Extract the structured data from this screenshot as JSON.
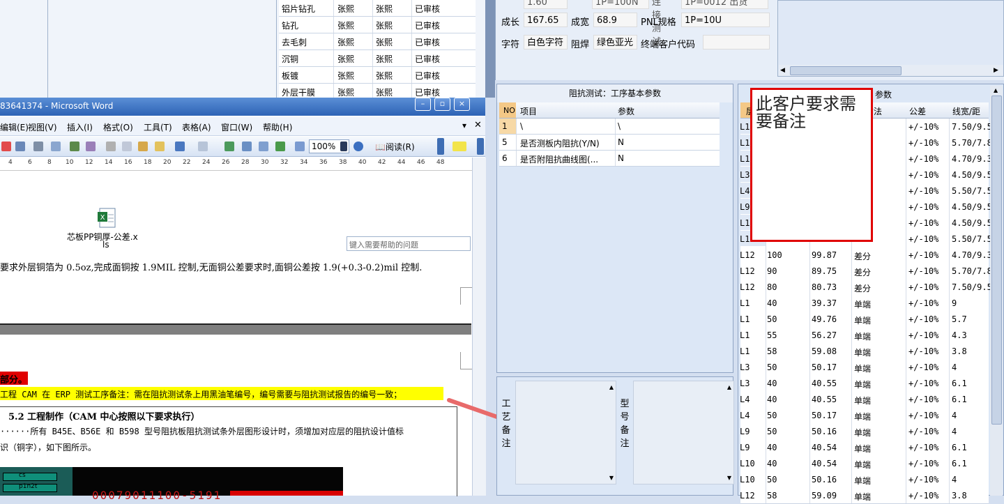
{
  "erp_process_table": [
    {
      "step": "铝片钻孔",
      "maker": "张熙",
      "checker": "张熙",
      "status": "已审核"
    },
    {
      "step": "钻孔",
      "maker": "张熙",
      "checker": "张熙",
      "status": "已审核"
    },
    {
      "step": "去毛刺",
      "maker": "张熙",
      "checker": "张熙",
      "status": "已审核"
    },
    {
      "step": "沉铜",
      "maker": "张熙",
      "checker": "张熙",
      "status": "已审核"
    },
    {
      "step": "板镀",
      "maker": "张熙",
      "checker": "张熙",
      "status": "已审核"
    },
    {
      "step": "外层干膜",
      "maker": "张熙",
      "checker": "张熙",
      "status": "已审核"
    }
  ],
  "word": {
    "title": "83641374 - Microsoft Word",
    "menu": [
      "编辑(E)",
      "视图(V)",
      "插入(I)",
      "格式(O)",
      "工具(T)",
      "表格(A)",
      "窗口(W)",
      "帮助(H)"
    ],
    "help_placeholder": "键入需要帮助的问题",
    "zoom": "100%",
    "read_label": "阅读(R)",
    "ruler": [
      "4",
      "6",
      "8",
      "10",
      "12",
      "14",
      "16",
      "18",
      "20",
      "22",
      "24",
      "26",
      "28",
      "30",
      "32",
      "34",
      "36",
      "38",
      "40",
      "42",
      "44",
      "46",
      "48"
    ],
    "embedded_file": "芯板PP铜厚-公差.x",
    "embedded_file_2": "ls",
    "line_copper": "要求外层铜箔为 0.5oz,完成面铜按 1.9MIL 控制,无面铜公差要求时,面铜公差按 1.9(+0.3-0.2)mil 控制.",
    "red_heading": "部分。",
    "yellow_line": "工程 CAM 在 ERP 测试工序备注：需在阻抗测试条上用黑油笔编号，编号需要与阻抗测试报告的编号一致；",
    "section_title": "5.2 工程制作（CAM 中心按照以下要求执行）",
    "para_1": "······所有 B45E、B56E 和 B598 型号阻抗板阻抗测试条外层图形设计时，须增加对应层的阻抗设计值标",
    "para_2": "识（铜字），如下图所示。",
    "fig_layers": [
      "cs",
      "p1n2t"
    ],
    "fig_text": "00079011100-5191"
  },
  "erp_header": {
    "row1": [
      {
        "label": "成长",
        "value": "167.65"
      },
      {
        "label": "成宽",
        "value": "68.9"
      },
      {
        "label": "PNL规格",
        "value": "1P=10U"
      }
    ],
    "row2": [
      {
        "label": "字符",
        "value": "白色字符"
      },
      {
        "label": "阻焊",
        "value": "绿色亚光"
      },
      {
        "label": "终端客户代码",
        "value": ""
      }
    ],
    "cut_top": [
      "1.60",
      "1P=100N",
      "连接测试",
      "1P=0012 出货"
    ]
  },
  "impedance_basic": {
    "caption": "阻抗测试：工序基本参数",
    "headers": [
      "NO",
      "项目",
      "参数"
    ],
    "rows": [
      {
        "no": "1",
        "item": "\\",
        "param": "\\"
      },
      {
        "no": "5",
        "item": "是否测板内阻抗(Y/N)",
        "param": "N"
      },
      {
        "no": "6",
        "item": "是否附阻抗曲线图(...",
        "param": "N"
      }
    ]
  },
  "notes": {
    "process_label": [
      "工",
      "艺",
      "备",
      "注"
    ],
    "model_label": [
      "型",
      "号",
      "备",
      "注"
    ]
  },
  "trace_table": {
    "caption_tail": "参数",
    "headers": [
      "层",
      "",
      "",
      "方法",
      "公差",
      "线宽/距"
    ],
    "rows": [
      [
        "L1",
        "",
        "",
        "",
        "+/-10%",
        "7.50/9.5"
      ],
      [
        "L1",
        "",
        "",
        "",
        "+/-10%",
        "5.70/7.8"
      ],
      [
        "L1",
        "",
        "",
        "",
        "+/-10%",
        "4.70/9.3"
      ],
      [
        "L3",
        "",
        "",
        "",
        "+/-10%",
        "4.50/9.5"
      ],
      [
        "L4",
        "",
        "",
        "",
        "+/-10%",
        "5.50/7.5"
      ],
      [
        "L9",
        "",
        "",
        "",
        "+/-10%",
        "4.50/9.5"
      ],
      [
        "L1",
        "",
        "",
        "",
        "+/-10%",
        "4.50/9.5"
      ],
      [
        "L1",
        "",
        "",
        "",
        "+/-10%",
        "5.50/7.5"
      ],
      [
        "L12",
        "100",
        "99.87",
        "差分",
        "+/-10%",
        "4.70/9.3"
      ],
      [
        "L12",
        "90",
        "89.75",
        "差分",
        "+/-10%",
        "5.70/7.8"
      ],
      [
        "L12",
        "80",
        "80.73",
        "差分",
        "+/-10%",
        "7.50/9.5"
      ],
      [
        "L1",
        "40",
        "39.37",
        "单端",
        "+/-10%",
        "9"
      ],
      [
        "L1",
        "50",
        "49.76",
        "单端",
        "+/-10%",
        "5.7"
      ],
      [
        "L1",
        "55",
        "56.27",
        "单端",
        "+/-10%",
        "4.3"
      ],
      [
        "L1",
        "58",
        "59.08",
        "单端",
        "+/-10%",
        "3.8"
      ],
      [
        "L3",
        "50",
        "50.17",
        "单端",
        "+/-10%",
        "4"
      ],
      [
        "L3",
        "40",
        "40.55",
        "单端",
        "+/-10%",
        "6.1"
      ],
      [
        "L4",
        "40",
        "40.55",
        "单端",
        "+/-10%",
        "6.1"
      ],
      [
        "L4",
        "50",
        "50.17",
        "单端",
        "+/-10%",
        "4"
      ],
      [
        "L9",
        "50",
        "50.16",
        "单端",
        "+/-10%",
        "4"
      ],
      [
        "L9",
        "40",
        "40.54",
        "单端",
        "+/-10%",
        "6.1"
      ],
      [
        "L10",
        "40",
        "40.54",
        "单端",
        "+/-10%",
        "6.1"
      ],
      [
        "L10",
        "50",
        "50.16",
        "单端",
        "+/-10%",
        "4"
      ],
      [
        "L12",
        "58",
        "59.09",
        "单端",
        "+/-10%",
        "3.8"
      ]
    ]
  },
  "callout_text": "此客户要求需要备注",
  "colors": {
    "callout_border": "#e00000",
    "highlight_yellow": "#ffff00",
    "highlight_red": "#e00000",
    "arrow": "#e86a6a"
  }
}
